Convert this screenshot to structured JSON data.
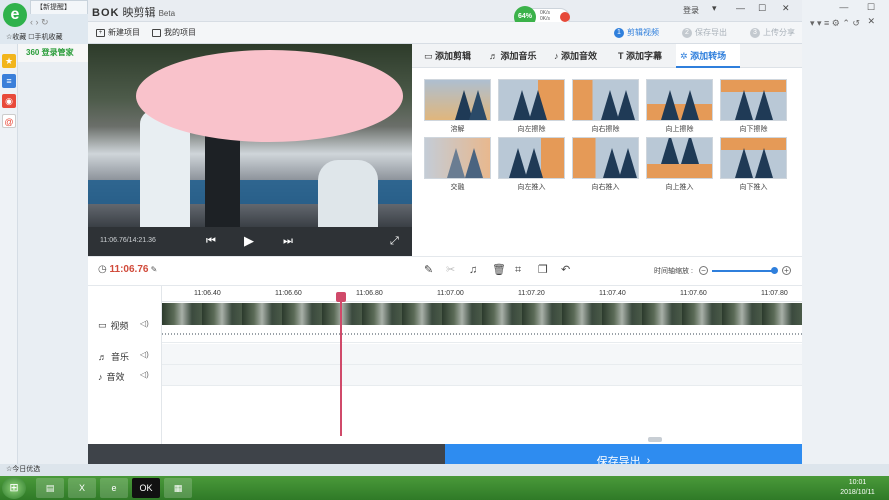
{
  "browser": {
    "tab_title": "【新提醒】",
    "nav_arrows": "‹ ›  ↻",
    "favorites": "☆收藏  ☐手机收藏",
    "extension_label": "360 登录管家",
    "status_text": "☆今日优选",
    "win_controls": "— ☐ ✕",
    "right_tools": "▾ ▾ ≡  ⚙  ⌃  ↺"
  },
  "app": {
    "logo_text": "BOK",
    "name": "映剪辑",
    "beta": "Beta",
    "speed_percent": "64%",
    "speed_up": "0K/s",
    "speed_down": "0K/s",
    "login": "登录",
    "win_menu": "▾",
    "win_min": "—",
    "win_max": "☐",
    "win_close": "✕"
  },
  "toolbar": {
    "new_project": "新建项目",
    "my_projects": "我的项目"
  },
  "steps": [
    {
      "num": "1",
      "label": "剪辑视频",
      "active": true
    },
    {
      "num": "2",
      "label": "保存导出",
      "active": false
    },
    {
      "num": "3",
      "label": "上传分享",
      "active": false
    }
  ],
  "player": {
    "timecode": "11:06.76/14:21.36"
  },
  "panel_tabs": [
    {
      "icon": "video-clip-icon",
      "glyph": "▭",
      "label": "添加剪辑"
    },
    {
      "icon": "music-icon",
      "glyph": "♬",
      "label": "添加音乐"
    },
    {
      "icon": "sound-effect-icon",
      "glyph": "♪",
      "label": "添加音效"
    },
    {
      "icon": "text-icon",
      "glyph": "T",
      "label": "添加字幕"
    },
    {
      "icon": "transition-icon",
      "glyph": "✲",
      "label": "添加转场"
    }
  ],
  "transitions": [
    "溶解",
    "向左擦除",
    "向右擦除",
    "向上擦除",
    "向下擦除",
    "交融",
    "向左推入",
    "向右推入",
    "向上推入",
    "向下推入"
  ],
  "edit": {
    "current_time": "11:06.76",
    "zoom_label": "时间轴缩放 :"
  },
  "ruler_ticks": [
    "11:06.40",
    "11:06.60",
    "11:06.80",
    "11:07.00",
    "11:07.20",
    "11:07.40",
    "11:07.60",
    "11:07.80"
  ],
  "tracks": [
    {
      "label": "视频",
      "icon": "video-track-icon"
    },
    {
      "label": "音乐",
      "icon": "music-track-icon"
    },
    {
      "label": "音效",
      "icon": "sfx-track-icon"
    }
  ],
  "save_button": "保存导出",
  "clock": {
    "time": "10:01",
    "date": "2018/10/11"
  },
  "colors": {
    "accent": "#2f7fdc",
    "save": "#2e8cf0",
    "current_time": "#d14a3a",
    "playhead": "#d04a6a"
  }
}
